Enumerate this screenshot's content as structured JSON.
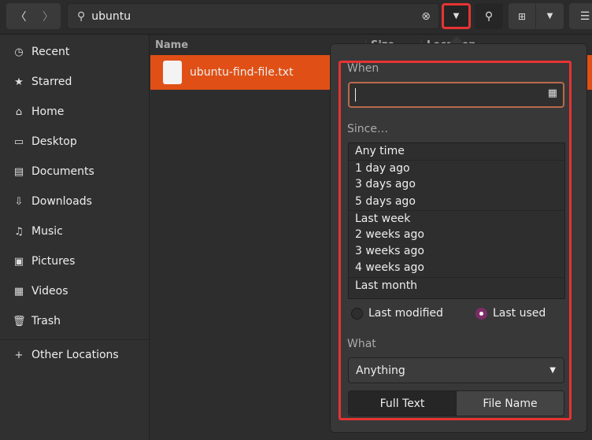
{
  "toolbar": {
    "search_value": "ubuntu",
    "back_icon": "chevron-left-icon",
    "forward_icon": "chevron-right-icon"
  },
  "columns": {
    "name": "Name",
    "size": "Size",
    "location": "Location"
  },
  "files": [
    {
      "name": "ubuntu-find-file.txt"
    }
  ],
  "sidebar": {
    "items": [
      {
        "label": "Recent",
        "icon": "clock-icon"
      },
      {
        "label": "Starred",
        "icon": "star-icon"
      },
      {
        "label": "Home",
        "icon": "home-icon"
      },
      {
        "label": "Desktop",
        "icon": "desktop-icon"
      },
      {
        "label": "Documents",
        "icon": "document-icon"
      },
      {
        "label": "Downloads",
        "icon": "download-icon"
      },
      {
        "label": "Music",
        "icon": "music-icon"
      },
      {
        "label": "Pictures",
        "icon": "picture-icon"
      },
      {
        "label": "Videos",
        "icon": "video-icon"
      },
      {
        "label": "Trash",
        "icon": "trash-icon"
      }
    ],
    "other": "Other Locations"
  },
  "popover": {
    "when_label": "When",
    "date_value": "",
    "since_label": "Since…",
    "since_options": [
      "Any time",
      "1 day ago",
      "3 days ago",
      "5 days ago",
      "Last week",
      "2 weeks ago",
      "3 weeks ago",
      "4 weeks ago",
      "Last month"
    ],
    "radio_modified": "Last modified",
    "radio_used": "Last used",
    "selected_radio": "Last used",
    "what_label": "What",
    "what_value": "Anything",
    "full_text": "Full Text",
    "file_name": "File Name",
    "selected_mode": "Full Text"
  },
  "colors": {
    "accent": "#e05016",
    "highlight": "#e63333",
    "radio": "#7d2c67"
  }
}
